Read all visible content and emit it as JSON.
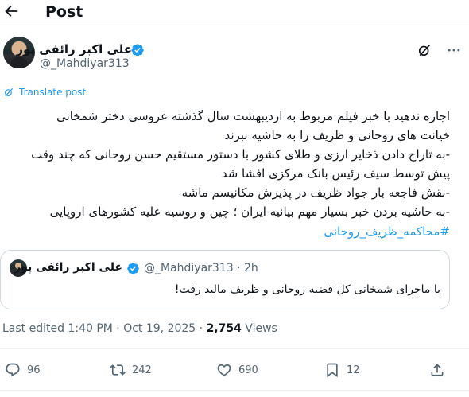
{
  "header": {
    "title": "Post"
  },
  "author": {
    "name": "علی اکبر رائفی پور",
    "handle": "@_Mahdiyar313"
  },
  "translate_label": "Translate post",
  "post": {
    "lines": [
      "اجازه ندهید با خبر فیلم مربوط به اردیبهشت سال گذشته عروسی دختر شمخانی",
      "خیانت های روحانی و ظریف را به حاشیه ببرند",
      "-به تاراج دادن ذخایر ارزی و طلای کشور با دستور مستقیم حسن روحانی که چند وقت",
      "پیش توسط سیف رئیس بانک مرکزی افشا شد",
      "-نقش فاجعه بار جواد ظریف در پذیرش مکانیسم ماشه",
      "-به حاشیه بردن خبر بسیار مهم بیانیه ایران ؛ چین و روسیه علیه کشورهای اروپایی"
    ],
    "hashtag": "#محاکمه_ظریف_روحانی"
  },
  "quote": {
    "name": "علی اکبر رائفی پور",
    "handle_time": "@_Mahdiyar313 · 2h",
    "text": "با ماجرای شمخانی کل قضیه روحانی و ظریف مالید رفت!"
  },
  "meta": {
    "timestamp": "Last edited 1:40 PM · Oct 19, 2025 · ",
    "views_count": "2,754",
    "views_label": " Views"
  },
  "actions": {
    "replies": "96",
    "reposts": "242",
    "likes": "690",
    "bookmarks": "12"
  },
  "icons": [
    "back-arrow-icon",
    "verified-badge-icon",
    "grok-icon",
    "more-icon",
    "translate-icon",
    "reply-icon",
    "repost-icon",
    "like-icon",
    "bookmark-icon",
    "share-icon"
  ],
  "colors": {
    "accent": "#1d9bf0",
    "text": "#0f1419",
    "muted": "#536471",
    "border": "#cfd9de"
  }
}
